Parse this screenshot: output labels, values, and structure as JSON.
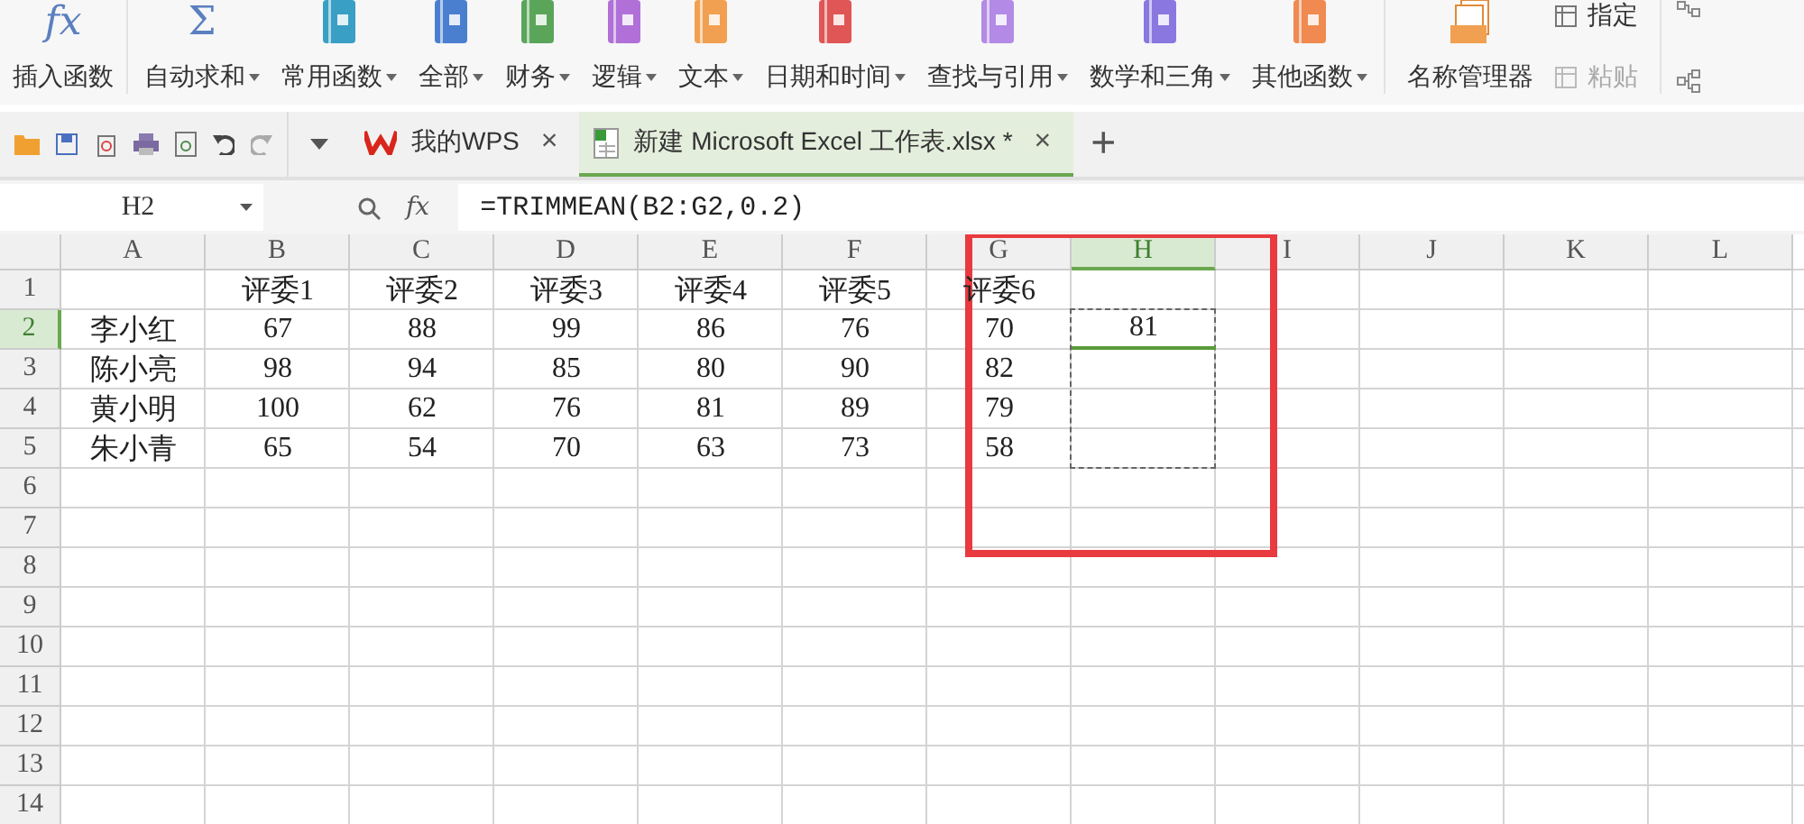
{
  "ribbon": {
    "groups": [
      {
        "kind": "large",
        "items": [
          {
            "label": "插入函数",
            "glyph": "fx",
            "dropdown": false
          }
        ]
      },
      {
        "kind": "books",
        "items": [
          {
            "label": "自动求和",
            "glyph": "Σ",
            "dropdown": true
          },
          {
            "label": "常用函数",
            "color": "#3a9fc4",
            "dropdown": true
          },
          {
            "label": "全部",
            "color": "#4a7fd0",
            "dropdown": true
          },
          {
            "label": "财务",
            "color": "#5aa55a",
            "dropdown": true
          },
          {
            "label": "逻辑",
            "color": "#b070d8",
            "dropdown": true
          },
          {
            "label": "文本",
            "color": "#f0a050",
            "dropdown": true
          },
          {
            "label": "日期和时间",
            "color": "#e05555",
            "dropdown": true
          },
          {
            "label": "查找与引用",
            "color": "#b38ae6",
            "dropdown": true
          },
          {
            "label": "数学和三角",
            "color": "#8a78e0",
            "dropdown": true
          },
          {
            "label": "其他函数",
            "color": "#f08a50",
            "dropdown": true
          }
        ]
      },
      {
        "kind": "names",
        "items": [
          {
            "label": "名称管理器",
            "dropdown": false
          }
        ],
        "small": [
          {
            "label": "指定",
            "disabled": false
          },
          {
            "label": "粘贴",
            "disabled": true
          }
        ]
      }
    ]
  },
  "tabs": [
    {
      "kind": "wps",
      "label": "我的WPS",
      "close": "×",
      "selected": false
    },
    {
      "kind": "sheet",
      "label": "新建 Microsoft Excel 工作表.xlsx *",
      "close": "×",
      "selected": true
    }
  ],
  "new_tab": "+",
  "formula_bar": {
    "name_box": "H2",
    "fx": "fx",
    "formula": "=TRIMMEAN(B2:G2,0.2)"
  },
  "sheet": {
    "columns": [
      {
        "name": "A",
        "selected": false
      },
      {
        "name": "B",
        "selected": false
      },
      {
        "name": "C",
        "selected": false
      },
      {
        "name": "D",
        "selected": false
      },
      {
        "name": "E",
        "selected": false
      },
      {
        "name": "F",
        "selected": false
      },
      {
        "name": "G",
        "selected": false
      },
      {
        "name": "H",
        "selected": true
      },
      {
        "name": "I",
        "selected": false
      },
      {
        "name": "J",
        "selected": false
      },
      {
        "name": "K",
        "selected": false
      },
      {
        "name": "L",
        "selected": false
      }
    ],
    "rows": [
      {
        "number": "1",
        "selected": false,
        "cells": [
          {
            "text": ""
          },
          {
            "text": "评委1"
          },
          {
            "text": "评委2"
          },
          {
            "text": "评委3"
          },
          {
            "text": "评委4"
          },
          {
            "text": "评委5"
          },
          {
            "text": "评委6"
          }
        ]
      },
      {
        "number": "2",
        "selected": true,
        "cells": [
          {
            "text": "李小红"
          },
          {
            "text": "67"
          },
          {
            "text": "88"
          },
          {
            "text": "99"
          },
          {
            "text": "86"
          },
          {
            "text": "76"
          },
          {
            "text": "70"
          },
          {
            "text": "81",
            "selected": true
          }
        ]
      },
      {
        "number": "3",
        "selected": false,
        "cells": [
          {
            "text": "陈小亮"
          },
          {
            "text": "98"
          },
          {
            "text": "94"
          },
          {
            "text": "85"
          },
          {
            "text": "80"
          },
          {
            "text": "90"
          },
          {
            "text": "82"
          },
          {
            "text": "",
            "selected": true
          }
        ]
      },
      {
        "number": "4",
        "selected": false,
        "cells": [
          {
            "text": "黄小明"
          },
          {
            "text": "100"
          },
          {
            "text": "62"
          },
          {
            "text": "76"
          },
          {
            "text": "81"
          },
          {
            "text": "89"
          },
          {
            "text": "79"
          },
          {
            "text": "",
            "selected": true
          }
        ]
      },
      {
        "number": "5",
        "selected": false,
        "cells": [
          {
            "text": "朱小青"
          },
          {
            "text": "65"
          },
          {
            "text": "54"
          },
          {
            "text": "70"
          },
          {
            "text": "63"
          },
          {
            "text": "73"
          },
          {
            "text": "58"
          },
          {
            "text": "",
            "selected": true
          }
        ]
      },
      {
        "number": "6",
        "selected": false,
        "cells": []
      },
      {
        "number": "7",
        "selected": false,
        "cells": []
      },
      {
        "number": "8",
        "selected": false,
        "cells": []
      },
      {
        "number": "9",
        "selected": false,
        "cells": []
      },
      {
        "number": "10",
        "selected": false,
        "cells": []
      },
      {
        "number": "11",
        "selected": false,
        "cells": []
      },
      {
        "number": "12",
        "selected": false,
        "cells": []
      },
      {
        "number": "13",
        "selected": false,
        "cells": []
      },
      {
        "number": "14",
        "selected": false,
        "cells": []
      }
    ]
  }
}
